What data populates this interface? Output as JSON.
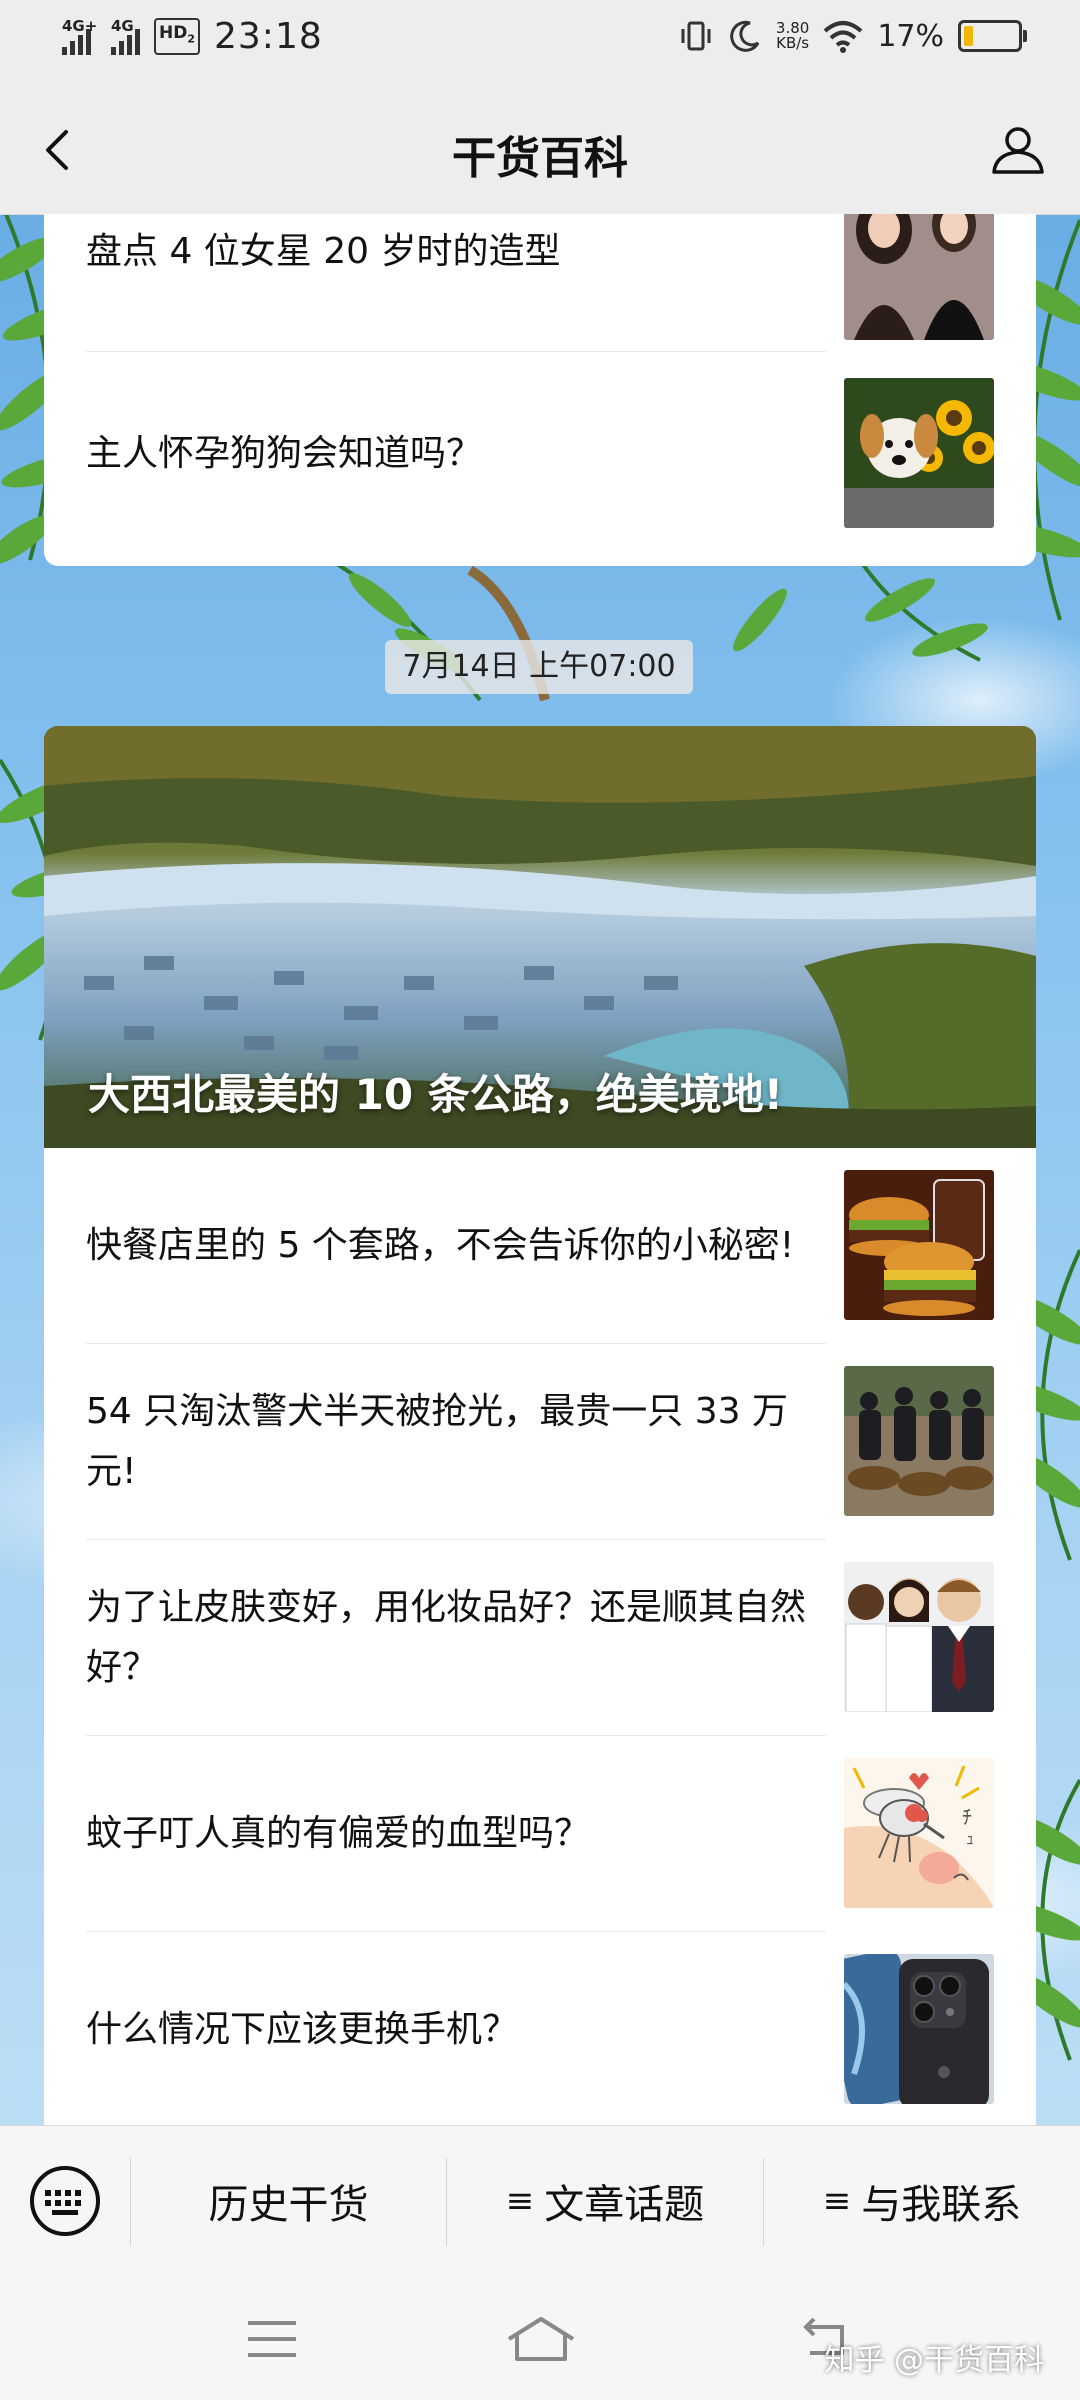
{
  "status_bar": {
    "network_1": "4G+",
    "network_2": "4G",
    "hd": "HD",
    "hd_sub": "2",
    "time": "23:18",
    "speed_value": "3.80",
    "speed_unit": "KB/s",
    "battery_percent": "17%",
    "battery_level": 0.17,
    "battery_color": "#f2b705"
  },
  "nav": {
    "title": "干货百科",
    "back_icon": "chevron-left-icon",
    "profile_icon": "user-icon"
  },
  "feed": {
    "top_card": [
      {
        "title": "盘点 4 位女星 20 岁时的造型",
        "thumb": "two-women-photo"
      },
      {
        "title": "主人怀孕狗狗会知道吗？",
        "thumb": "puppy-sunflower-photo"
      }
    ],
    "timestamp": "7月14日 上午07:00",
    "featured": {
      "title": "大西北最美的 10 条公路，绝美境地!",
      "image": "forest-village-photo"
    },
    "articles": [
      {
        "title": "快餐店里的 5 个套路，不会告诉你的小秘密!",
        "thumb": "burger-photo"
      },
      {
        "title": "54 只淘汰警犬半天被抢光，最贵一只 33 万元!",
        "thumb": "police-dogs-photo"
      },
      {
        "title": "为了让皮肤变好，用化妆品好？还是顺其自然好？",
        "thumb": "smiling-people-photo"
      },
      {
        "title": "蚊子叮人真的有偏爱的血型吗？",
        "thumb": "mosquito-cartoon"
      },
      {
        "title": "什么情况下应该更换手机？",
        "thumb": "smartphone-photo"
      }
    ]
  },
  "bottom_menu": {
    "keyboard_icon": "keyboard-icon",
    "items": [
      {
        "label": "历史干货",
        "has_menu": false
      },
      {
        "label": "文章话题",
        "has_menu": true
      },
      {
        "label": "与我联系",
        "has_menu": true
      }
    ],
    "menu_glyph": "≡"
  },
  "system_nav": {
    "watermark": "知乎 @干货百科"
  }
}
